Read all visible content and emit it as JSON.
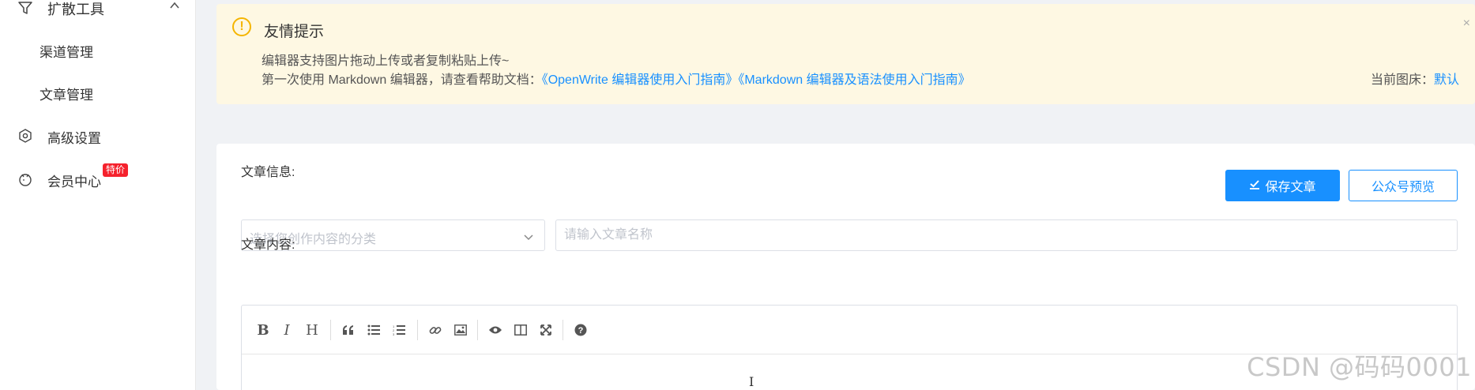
{
  "sidebar": {
    "group": {
      "label": "扩散工具",
      "icon": "filter-icon"
    },
    "sub_items": [
      {
        "label": "渠道管理"
      },
      {
        "label": "文章管理"
      }
    ],
    "items": [
      {
        "label": "高级设置",
        "icon": "hexagon-settings-icon"
      },
      {
        "label": "会员中心",
        "icon": "member-icon",
        "badge": "特价"
      }
    ]
  },
  "alert": {
    "title": "友情提示",
    "line1": "编辑器支持图片拖动上传或者复制粘贴上传~",
    "line2_prefix": "第一次使用 Markdown 编辑器，请查看帮助文档：",
    "link1": "《OpenWrite 编辑器使用入门指南》",
    "link2": "《Markdown 编辑器及语法使用入门指南》",
    "bed_label": "当前图床：",
    "bed_value": "默认",
    "close": "×",
    "warn_symbol": "!"
  },
  "card": {
    "save_button": "保存文章",
    "preview_button": "公众号预览",
    "info_label": "文章信息:",
    "category_placeholder": "选择您创作内容的分类",
    "title_placeholder": "请输入文章名称",
    "content_label": "文章内容:"
  },
  "editor": {
    "cursor": "I"
  },
  "watermark": "CSDN @码码0001",
  "colors": {
    "primary": "#1890ff",
    "alert_bg": "#fef8e3",
    "warn": "#f5b500",
    "badge": "#f5222d"
  }
}
